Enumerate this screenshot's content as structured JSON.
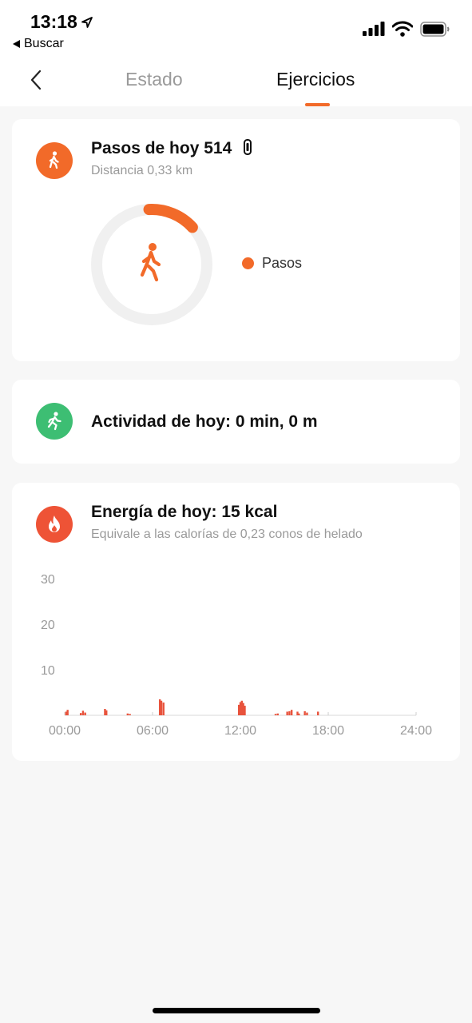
{
  "status_bar": {
    "time": "13:18",
    "back_app": "Buscar"
  },
  "nav": {
    "tabs": [
      {
        "label": "Estado"
      },
      {
        "label": "Ejercicios"
      }
    ],
    "active_tab": "Ejercicios"
  },
  "steps_card": {
    "title": "Pasos de hoy 514",
    "distance": "Distancia 0,33 km",
    "legend_label": "Pasos",
    "progress_fraction": 0.14,
    "icon": "walking-person-icon",
    "accent": "#f26a29"
  },
  "activity_card": {
    "title": "Actividad de hoy: 0 min, 0 m",
    "icon": "running-person-icon",
    "accent": "#3dbe73"
  },
  "energy_card": {
    "title": "Energía de hoy: 15 kcal",
    "subtitle": "Equivale a las calorías de 0,23 conos de helado",
    "icon": "flame-icon",
    "accent": "#ee5336"
  },
  "chart_data": {
    "type": "bar",
    "title": "",
    "xlabel": "",
    "ylabel": "",
    "y_ticks": [
      "10",
      "20",
      "30"
    ],
    "x_ticks": [
      "00:00",
      "06:00",
      "12:00",
      "18:00",
      "24:00"
    ],
    "ylim": [
      0,
      30
    ],
    "xlim": [
      0,
      24
    ],
    "color": "#e8533c",
    "x": [
      0.1,
      0.2,
      1.1,
      1.25,
      1.4,
      2.75,
      2.85,
      4.3,
      4.45,
      6.5,
      6.6,
      6.75,
      11.9,
      12.0,
      12.1,
      12.2,
      12.3,
      14.4,
      14.55,
      15.2,
      15.35,
      15.5,
      15.9,
      16.0,
      16.4,
      16.55,
      17.3
    ],
    "values": [
      0.8,
      1.2,
      0.5,
      1.0,
      0.6,
      1.4,
      1.1,
      0.4,
      0.3,
      3.5,
      3.2,
      2.8,
      2.3,
      2.9,
      3.2,
      2.7,
      2.1,
      0.3,
      0.4,
      0.8,
      0.9,
      1.2,
      0.8,
      0.4,
      0.9,
      0.6,
      0.8
    ]
  }
}
